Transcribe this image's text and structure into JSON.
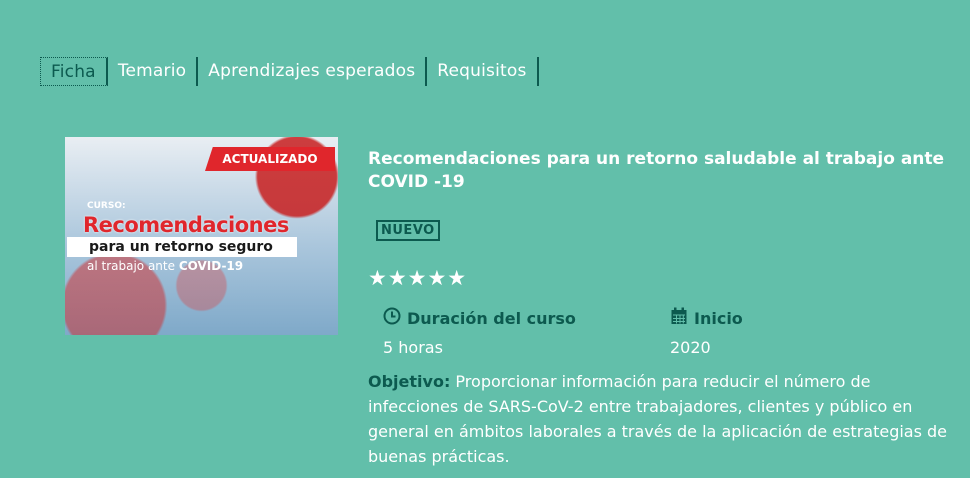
{
  "tabs": [
    {
      "label": "Ficha",
      "active": true
    },
    {
      "label": "Temario",
      "active": false
    },
    {
      "label": "Aprendizajes esperados",
      "active": false
    },
    {
      "label": "Requisitos",
      "active": false
    }
  ],
  "thumbnail": {
    "badge": "ACTUALIZADO",
    "kicker": "CURSO:",
    "headline": "Recomendaciones",
    "line2": "para un retorno seguro",
    "line3_prefix": "al trabajo ante ",
    "line3_bold": "COVID-19"
  },
  "course": {
    "title": "Recomendaciones para un retorno saludable al trabajo ante COVID -19",
    "badge": "NUEVO",
    "stars": "★★★★★",
    "rating_stars": 5,
    "duration_label": "Duración del curso",
    "duration_value": "5 horas",
    "start_label": "Inicio",
    "start_value": "2020",
    "objective_label": "Objetivo:",
    "objective_text": " Proporcionar información para reducir el número de infecciones de SARS-CoV-2 entre trabajadores, clientes y público en general en ámbitos laborales a través de la aplicación de estrategias de buenas prácticas."
  },
  "colors": {
    "background": "#62bfaa",
    "accent_dark": "#0c5a4f",
    "badge_red": "#e0262c"
  },
  "icons": {
    "duration": "clock-icon",
    "start": "calendar-icon"
  }
}
